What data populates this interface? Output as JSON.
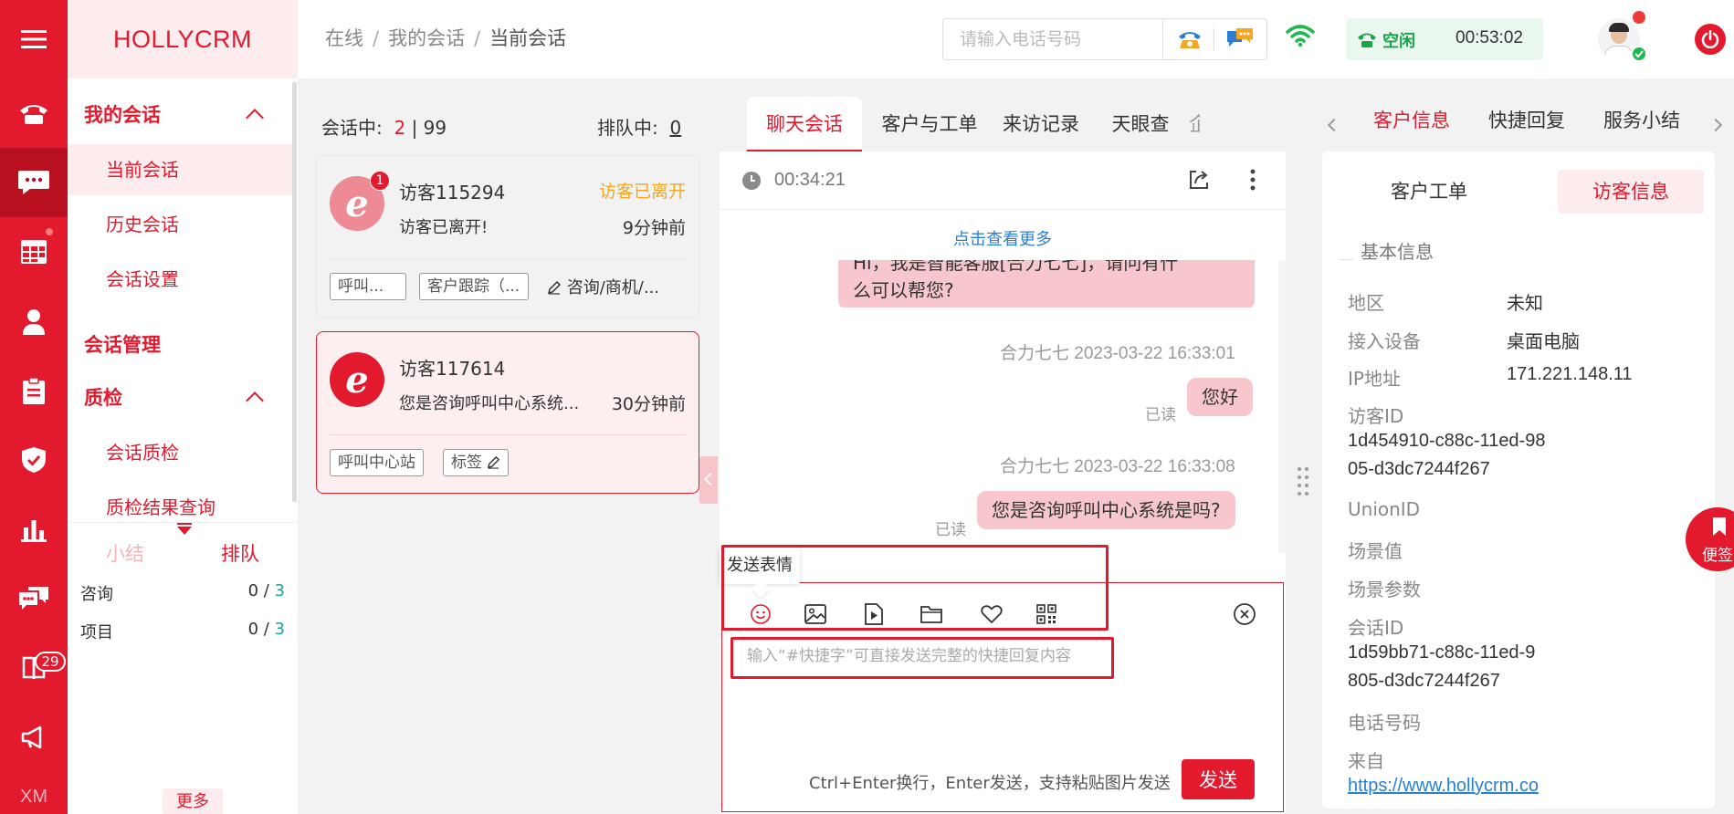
{
  "brand": "HOLLYCRM",
  "rail": {
    "badge": "29",
    "footer": "XM"
  },
  "nav": {
    "group_my": "我的会话",
    "current": "当前会话",
    "history": "历史会话",
    "settings": "会话设置",
    "manage": "会话管理",
    "qc": "质检",
    "qc_session": "会话质检",
    "qc_query": "质检结果查询",
    "tab_summary": "小结",
    "tab_queue": "排队",
    "stats": [
      {
        "label": "咨询",
        "num": "0",
        "den": "3"
      },
      {
        "label": "项目",
        "num": "0",
        "den": "3"
      }
    ],
    "more": "更多"
  },
  "breadcrumb": {
    "a": "在线",
    "b": "我的会话",
    "c": "当前会话",
    "sep": "/"
  },
  "phone": {
    "placeholder": "请输入电话号码"
  },
  "status": {
    "label": "空闲",
    "time": "00:53:02"
  },
  "conv": {
    "label_active": "会话中:",
    "active": "2",
    "bar": "|",
    "total": "99",
    "label_queue": "排队中:",
    "queue": "0",
    "cards": [
      {
        "unread": "1",
        "name": "访客115294",
        "state": "访客已离开",
        "msg": "访客已离开!",
        "ago": "9分钟前",
        "tag1": "呼叫...",
        "tag2": "客户跟踪（...",
        "tag3": "咨询/商机/..."
      },
      {
        "name": "访客117614",
        "msg": "您是咨询呼叫中心系统...",
        "ago": "30分钟前",
        "tag1": "呼叫中心站",
        "tag2": "标签"
      }
    ]
  },
  "center_tabs": [
    "聊天会话",
    "客户与工单",
    "来访记录",
    "天眼查",
    "企"
  ],
  "chat": {
    "timer": "00:34:21",
    "view_more": "点击查看更多",
    "msg1_line1": "Hi，我是智能客服[合力七七]，请问有什",
    "msg1_line2": "么可以帮您?",
    "meta2": "合力七七 2023-03-22 16:33:01",
    "msg2": "您好",
    "read": "已读",
    "meta3": "合力七七 2023-03-22 16:33:08",
    "msg3": "您是咨询呼叫中心系统是吗?",
    "tooltip": "发送表情",
    "input_placeholder": "输入“#快捷字”可直接发送完整的快捷回复内容",
    "hint": "Ctrl+Enter换行，Enter发送，支持粘贴图片发送",
    "send": "发送"
  },
  "right_tabs": [
    "客户信息",
    "快捷回复",
    "服务小结"
  ],
  "right": {
    "subtab_ticket": "客户工单",
    "subtab_visitor": "访客信息",
    "section": "基本信息",
    "region_label": "地区",
    "region": "未知",
    "device_label": "接入设备",
    "device": "桌面电脑",
    "ip_label": "IP地址",
    "ip": "171.221.148.11",
    "visitor_id_label": "访客ID",
    "visitor_id_1": "1d454910-c88c-11ed-98",
    "visitor_id_2": "05-d3dc7244f267",
    "union_label": "UnionID",
    "scene_label": "场景值",
    "scene_param_label": "场景参数",
    "session_id_label": "会话ID",
    "session_id_1": "1d59bb71-c88c-11ed-9",
    "session_id_2": "805-d3dc7244f267",
    "phone_label": "电话号码",
    "from_label": "来自",
    "from": "https://www.hollycrm.co"
  },
  "sticky": "便签",
  "colors": {
    "brand": "#e3192e",
    "link": "#2a7fd4",
    "warn": "#f5a623",
    "ok": "#19a34a"
  }
}
